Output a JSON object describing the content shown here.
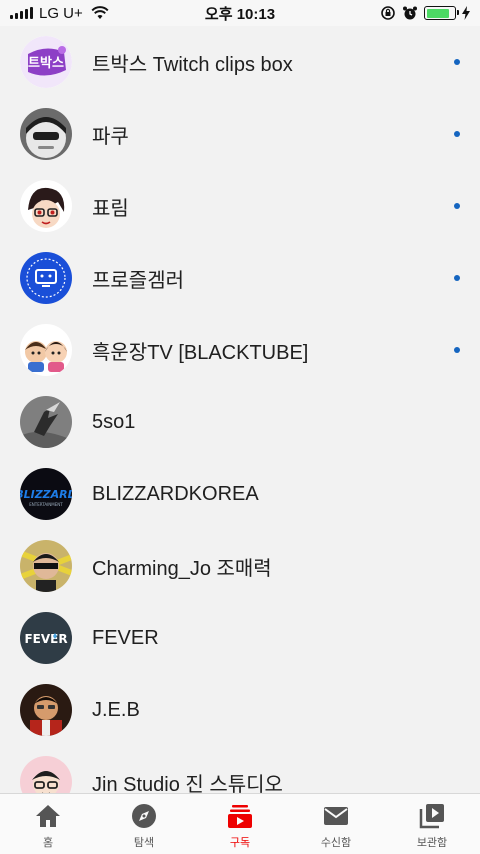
{
  "status_bar": {
    "carrier": "LG U+",
    "time": "오후 10:13",
    "battery_level": 0.85
  },
  "subscriptions": [
    {
      "name": "트박스 Twitch clips box",
      "avatar": "twitch-clips-box-logo",
      "has_new": true
    },
    {
      "name": "파쿠",
      "avatar": "paku-avatar",
      "has_new": true
    },
    {
      "name": "표림",
      "avatar": "pyorim-avatar",
      "has_new": true
    },
    {
      "name": "프로즐겜러",
      "avatar": "happy-gamer-logo",
      "has_new": true
    },
    {
      "name": "흑운장TV [BLACKTUBE]",
      "avatar": "blacktube-avatar",
      "has_new": true
    },
    {
      "name": "5so1",
      "avatar": "5so1-avatar",
      "has_new": false
    },
    {
      "name": "BLIZZARDKOREA",
      "avatar": "blizzard-logo",
      "has_new": false
    },
    {
      "name": "Charming_Jo 조매력",
      "avatar": "charming-jo-avatar",
      "has_new": false
    },
    {
      "name": "FEVER",
      "avatar": "fever-logo",
      "has_new": false
    },
    {
      "name": "J.E.B",
      "avatar": "jeb-avatar",
      "has_new": false
    },
    {
      "name": "Jin Studio 진 스튜디오",
      "avatar": "jin-studio-avatar",
      "has_new": false
    }
  ],
  "bottom_nav": [
    {
      "label": "홈",
      "icon": "home-icon",
      "active": false
    },
    {
      "label": "탐색",
      "icon": "explore-icon",
      "active": false
    },
    {
      "label": "구독",
      "icon": "subscriptions-icon",
      "active": true
    },
    {
      "label": "수신함",
      "icon": "inbox-icon",
      "active": false
    },
    {
      "label": "보관함",
      "icon": "library-icon",
      "active": false
    }
  ],
  "colors": {
    "accent": "#e00000",
    "new_dot": "#1565c0",
    "background": "#f2f2f2"
  }
}
